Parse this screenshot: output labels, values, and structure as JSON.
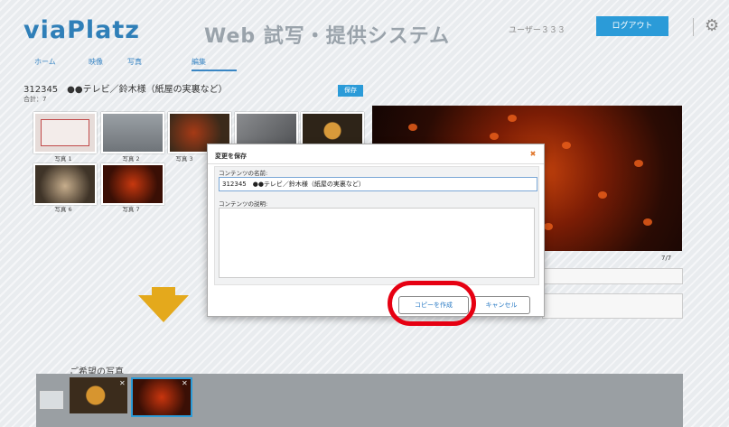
{
  "header": {
    "logo": "viaPlatz",
    "system_title": "Web 試写・提供システム",
    "user_name": "ユーザー３３３",
    "logout_label": "ログアウト",
    "settings_icon": "gear-icon"
  },
  "nav": {
    "tabs": [
      {
        "label": "ホーム"
      },
      {
        "label": "映像"
      },
      {
        "label": "写真"
      },
      {
        "label": "編集"
      }
    ],
    "active_tab": "編集"
  },
  "content": {
    "title": "312345　●●テレビ／鈴木様（紙屋の実裏など）",
    "subtitle": "合計：7",
    "save_label": "保存"
  },
  "thumbnails": [
    {
      "label": "写真 1",
      "color": "#d8c7c3"
    },
    {
      "label": "写真 2",
      "color": "#8e9296"
    },
    {
      "label": "写真 3",
      "color": "#7a3a1e"
    },
    {
      "label": "",
      "color": "#6d6e70"
    },
    {
      "label": "",
      "color": "#4a3520"
    },
    {
      "label": "写真 6",
      "color": "#6b5a45"
    },
    {
      "label": "写真 7",
      "color": "#7a1e0a"
    }
  ],
  "preview": {
    "counter": "7/7"
  },
  "wanted": {
    "label": "ご希望の写真"
  },
  "modal": {
    "title": "変更を保存",
    "close_icon": "close-icon",
    "name_label": "コンテンツの名前:",
    "name_value": "312345　●●テレビ／鈴木様（紙屋の実裏など）",
    "desc_label": "コンテンツの説明:",
    "desc_value": "",
    "copy_label": "コピーを作成",
    "cancel_label": "キャンセル"
  },
  "colors": {
    "accent": "#2b9bd8",
    "highlight": "#e60012",
    "arrow": "#e4a91c"
  }
}
